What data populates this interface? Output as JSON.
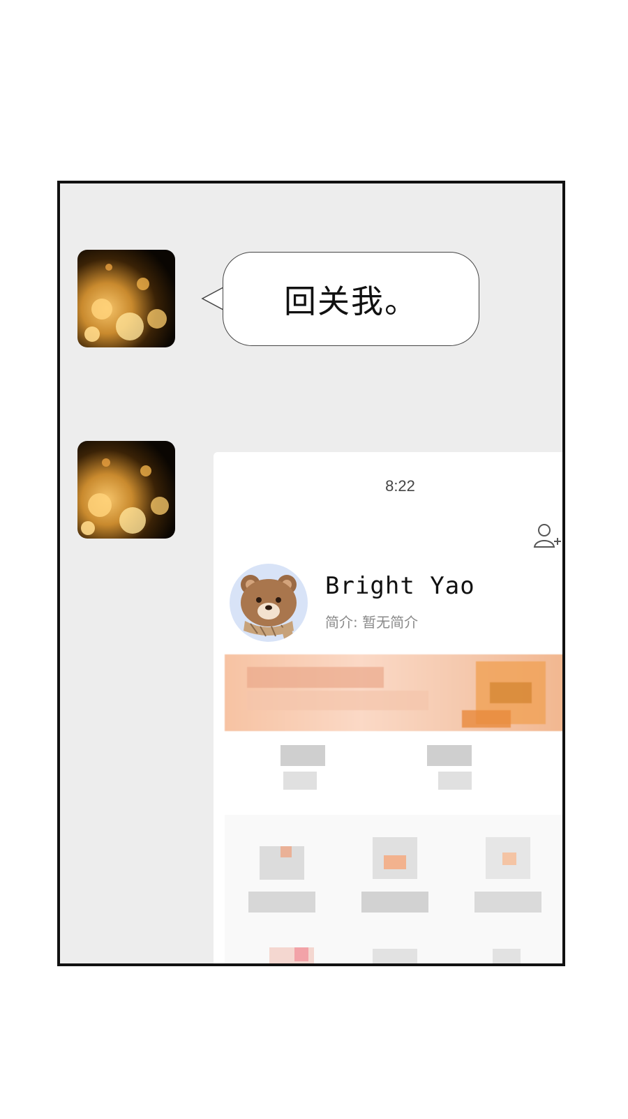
{
  "chat": {
    "message_text": "回关我。"
  },
  "screenshot": {
    "time": "8:22",
    "profile": {
      "name": "Bright Yao",
      "bio": "简介: 暂无简介"
    },
    "icons": {
      "add_friend": "add-friend-icon",
      "avatar": "bear-avatar-icon"
    }
  },
  "colors": {
    "panel_bg": "#ededed",
    "panel_border": "#111111",
    "banner": "#f7c3a3"
  }
}
